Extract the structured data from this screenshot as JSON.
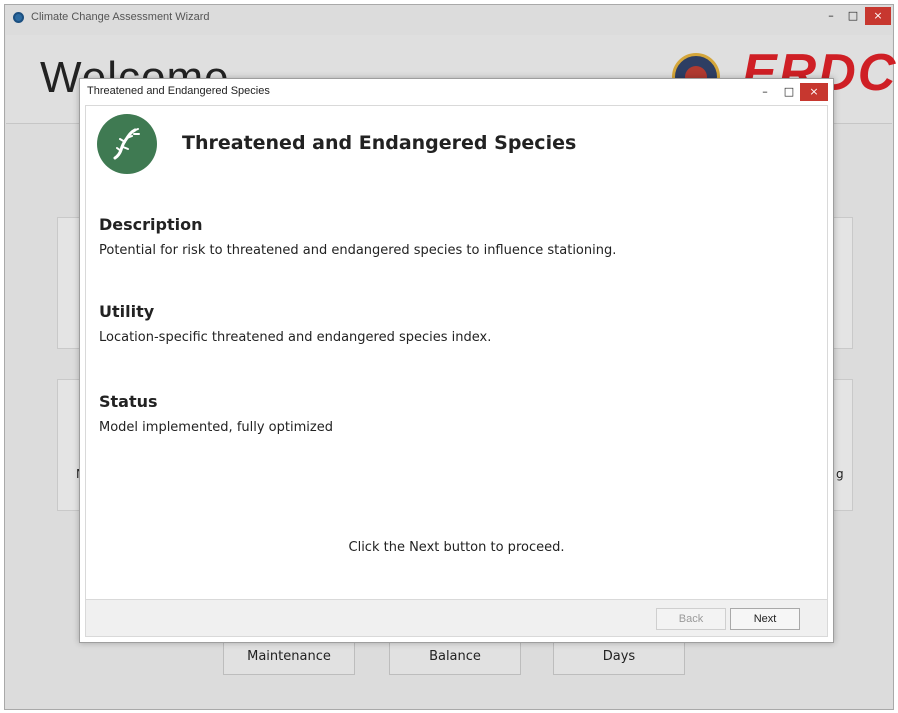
{
  "main": {
    "title": "Climate Change Assessment Wizard",
    "window_controls": {
      "minimize": "–",
      "maximize": "□",
      "close": "×"
    },
    "welcome": "Welcome",
    "brand": "ERDC",
    "fragments": {
      "left": "N",
      "right": "g"
    },
    "bottom_buttons": [
      "Maintenance",
      "Balance",
      "Days"
    ]
  },
  "dialog": {
    "title": "Threatened and Endangered Species",
    "window_controls": {
      "minimize": "–",
      "maximize": "□",
      "close": "×"
    },
    "heading": "Threatened and Endangered Species",
    "icon": "gecko-icon",
    "icon_color": "#3f7a52",
    "sections": [
      {
        "title": "Description",
        "text": "Potential for risk to threatened and endangered species to influence stationing."
      },
      {
        "title": "Utility",
        "text": "Location-specific threatened and endangered species index."
      },
      {
        "title": "Status",
        "text": "Model implemented, fully optimized"
      }
    ],
    "instruction": "Click the Next button to proceed.",
    "buttons": {
      "back": "Back",
      "next": "Next"
    }
  },
  "colors": {
    "close_button": "#c7372f",
    "brand": "#cf1f25"
  }
}
